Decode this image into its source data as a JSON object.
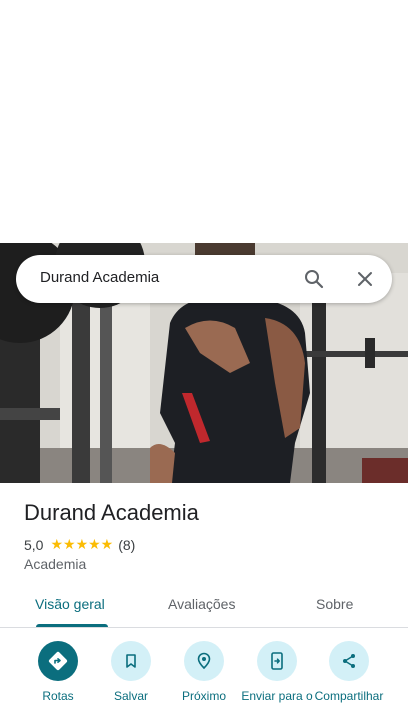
{
  "search": {
    "query": "Durand Academia"
  },
  "place": {
    "name": "Durand Academia",
    "rating": "5,0",
    "stars": "★★★★★",
    "review_count": "(8)",
    "category": "Academia"
  },
  "tabs": [
    {
      "label": "Visão geral",
      "active": true
    },
    {
      "label": "Avaliações",
      "active": false
    },
    {
      "label": "Sobre",
      "active": false
    }
  ],
  "actions": [
    {
      "label": "Rotas",
      "icon": "directions-icon"
    },
    {
      "label": "Salvar",
      "icon": "bookmark-icon"
    },
    {
      "label": "Próximo",
      "icon": "nearby-icon"
    },
    {
      "label": "Enviar para o",
      "icon": "send-to-phone-icon"
    },
    {
      "label": "Compartilhar",
      "icon": "share-icon"
    }
  ],
  "colors": {
    "accent": "#0b6e7e",
    "accent_light": "#d3f0f7",
    "star": "#fbbc04"
  }
}
